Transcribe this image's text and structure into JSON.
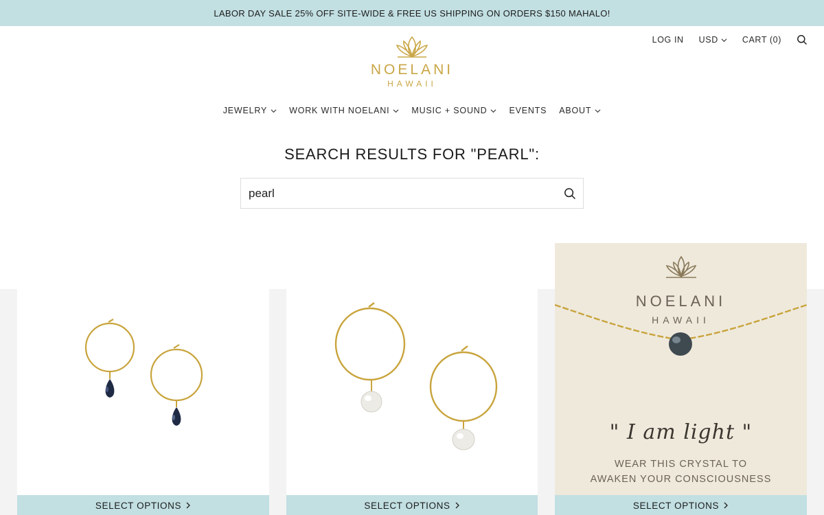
{
  "announcement": "LABOR DAY SALE 25% OFF SITE-WIDE & FREE US SHIPPING ON ORDERS $150 MAHALO!",
  "utility": {
    "login": "LOG IN",
    "currency": "USD",
    "cart": "CART (0)"
  },
  "logo": {
    "brand": "NOELANI",
    "sub": "HAWAII"
  },
  "nav": [
    {
      "label": "JEWELRY",
      "dropdown": true
    },
    {
      "label": "WORK WITH NOELANI",
      "dropdown": true
    },
    {
      "label": "MUSIC + SOUND",
      "dropdown": true
    },
    {
      "label": "EVENTS",
      "dropdown": false
    },
    {
      "label": "ABOUT",
      "dropdown": true
    }
  ],
  "results_title": "SEARCH RESULTS FOR \"PEARL\":",
  "search": {
    "value": "pearl"
  },
  "products": [
    {
      "button": "SELECT OPTIONS"
    },
    {
      "button": "SELECT OPTIONS"
    },
    {
      "button": "SELECT OPTIONS",
      "card_brand": "NOELANI",
      "card_sub": "HAWAII",
      "quote": "\" I am light \"",
      "line1": "WEAR THIS CRYSTAL TO",
      "line2": "AWAKEN YOUR CONSCIOUSNESS"
    }
  ],
  "colors": {
    "accent": "#c2dfe2",
    "gold": "#c9a646",
    "band": "#f3f3f3"
  },
  "icons": [
    "chevron-down-icon",
    "search-icon",
    "lotus-logo-icon",
    "chevron-right-icon"
  ]
}
